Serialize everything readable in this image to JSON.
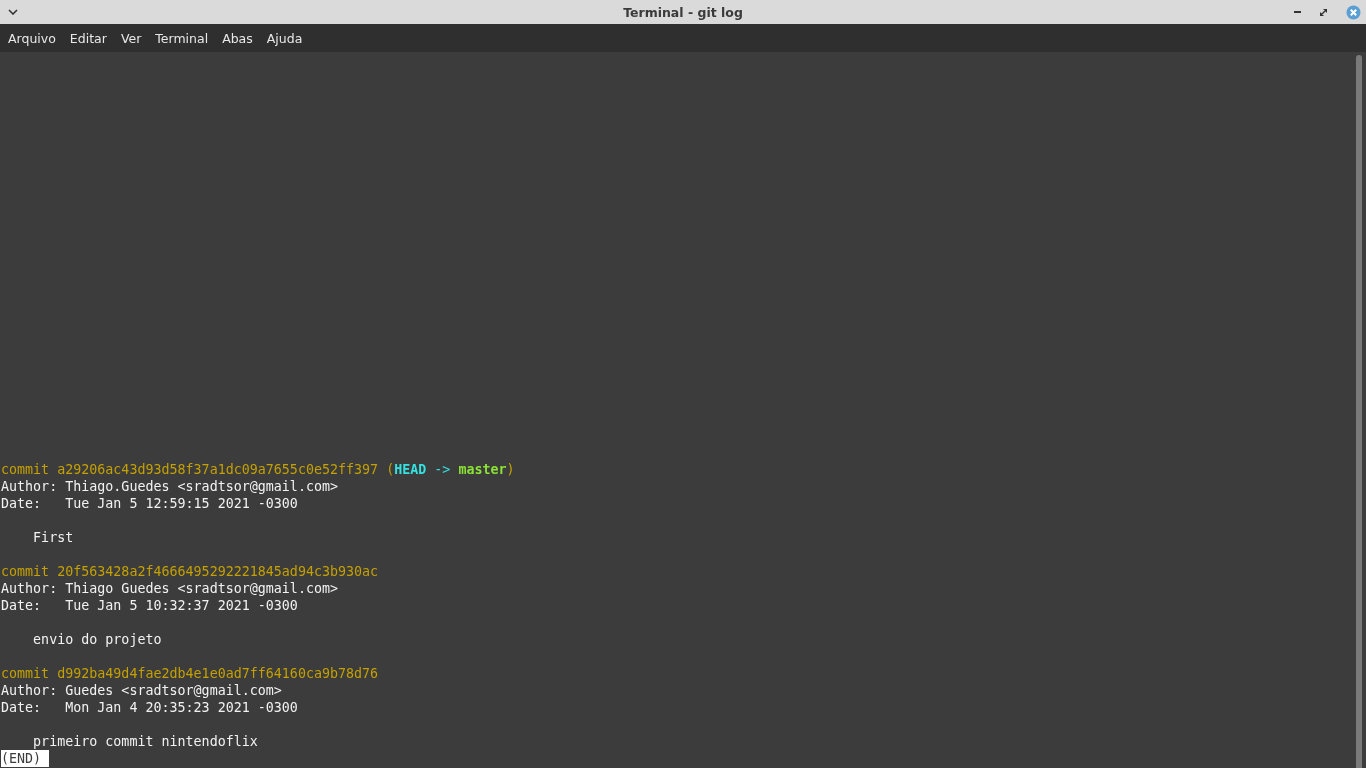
{
  "window": {
    "title": "Terminal - git log"
  },
  "menu": [
    "Arquivo",
    "Editar",
    "Ver",
    "Terminal",
    "Abas",
    "Ajuda"
  ],
  "commits": [
    {
      "commit": "commit a29206ac43d93d58f37a1dc09a7655c0e52ff397",
      "decoration": {
        "open": "(",
        "head": "HEAD",
        "arrow": "->",
        "branch": "master",
        "close": ")"
      },
      "author": "Author: Thiago.Guedes <sradtsor@gmail.com>",
      "date": "Date:   Tue Jan 5 12:59:15 2021 -0300",
      "message": "First"
    },
    {
      "commit": "commit 20f563428a2f4666495292221845ad94c3b930ac",
      "author": "Author: Thiago Guedes <sradtsor@gmail.com>",
      "date": "Date:   Tue Jan 5 10:32:37 2021 -0300",
      "message": "envio do projeto"
    },
    {
      "commit": "commit d992ba49d4fae2db4e1e0ad7ff64160ca9b78d76",
      "author": "Author: Guedes <sradtsor@gmail.com>",
      "date": "Date:   Mon Jan 4 20:35:23 2021 -0300",
      "message": "primeiro commit nintendoflix"
    }
  ],
  "pager_prompt": "(END)"
}
